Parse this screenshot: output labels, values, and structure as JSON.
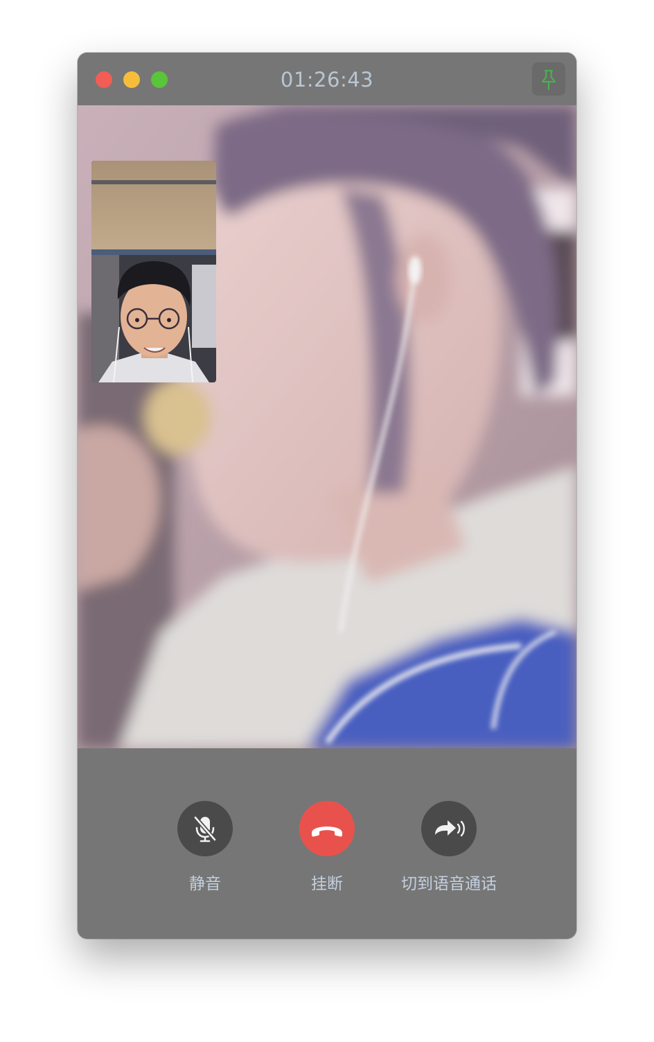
{
  "window": {
    "call_timer": "01:26:43"
  },
  "controls": {
    "mute_label": "静音",
    "hangup_label": "挂断",
    "switch_voice_label": "切到语音通话"
  },
  "icons": {
    "pin": "pin-icon",
    "mute": "microphone-muted-icon",
    "hangup": "phone-hangup-icon",
    "switch_voice": "switch-to-voice-icon"
  },
  "colors": {
    "window_bg": "#767676",
    "timer_text": "#b9c6d4",
    "label_text": "#c3d0de",
    "hangup_red": "#e9524c",
    "control_dark": "#4a4a4a",
    "pin_green": "#4caf50",
    "traffic_red": "#f25d55",
    "traffic_yellow": "#f6bd3b",
    "traffic_green": "#5ac43a"
  }
}
